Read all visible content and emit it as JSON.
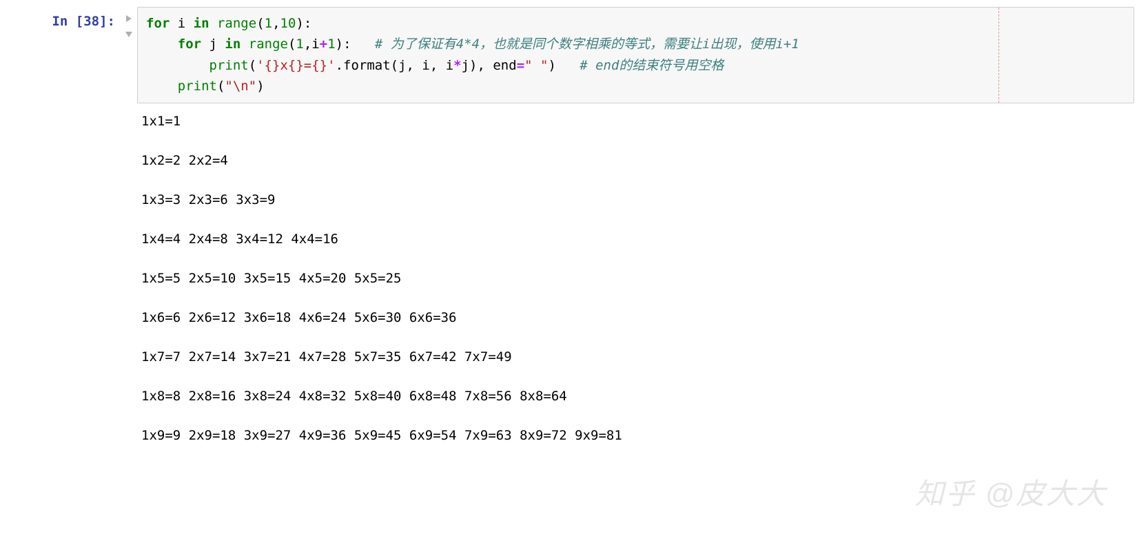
{
  "prompt": "In [38]:",
  "code": {
    "line1": {
      "kw_for": "for",
      "var_i": " i ",
      "kw_in": "in",
      "fn_range": " range",
      "paren_open": "(",
      "n1": "1",
      "comma": ",",
      "n10": "10",
      "paren_close": "):"
    },
    "line2": {
      "indent": "    ",
      "kw_for": "for",
      "var_j": " j ",
      "kw_in": "in",
      "fn_range": " range",
      "paren_open": "(",
      "n1": "1",
      "comma": ",i",
      "plus": "+",
      "n1b": "1",
      "paren_close": "):   ",
      "comment": "# 为了保证有4*4，也就是同个数字相乘的等式，需要让i出现，使用i+1"
    },
    "line3": {
      "indent": "        ",
      "fn_print": "print",
      "paren_open": "(",
      "str1": "'{}x{}={}'",
      "dot_format": ".format(j, i, i",
      "star": "*",
      "rest": "j), end",
      "eq": "=",
      "str2": "\" \"",
      "paren_close": ")   ",
      "comment": "# end的结束符号用空格"
    },
    "line4": {
      "indent": "    ",
      "fn_print": "print",
      "paren_open": "(",
      "str": "\"\\n\"",
      "paren_close": ")"
    }
  },
  "output": "1x1=1 \n\n1x2=2 2x2=4 \n\n1x3=3 2x3=6 3x3=9 \n\n1x4=4 2x4=8 3x4=12 4x4=16 \n\n1x5=5 2x5=10 3x5=15 4x5=20 5x5=25 \n\n1x6=6 2x6=12 3x6=18 4x6=24 5x6=30 6x6=36 \n\n1x7=7 2x7=14 3x7=21 4x7=28 5x7=35 6x7=42 7x7=49 \n\n1x8=8 2x8=16 3x8=24 4x8=32 5x8=40 6x8=48 7x8=56 8x8=64 \n\n1x9=9 2x9=18 3x9=27 4x9=36 5x9=45 6x9=54 7x9=63 8x9=72 9x9=81 ",
  "watermark": "知乎 @皮大大"
}
